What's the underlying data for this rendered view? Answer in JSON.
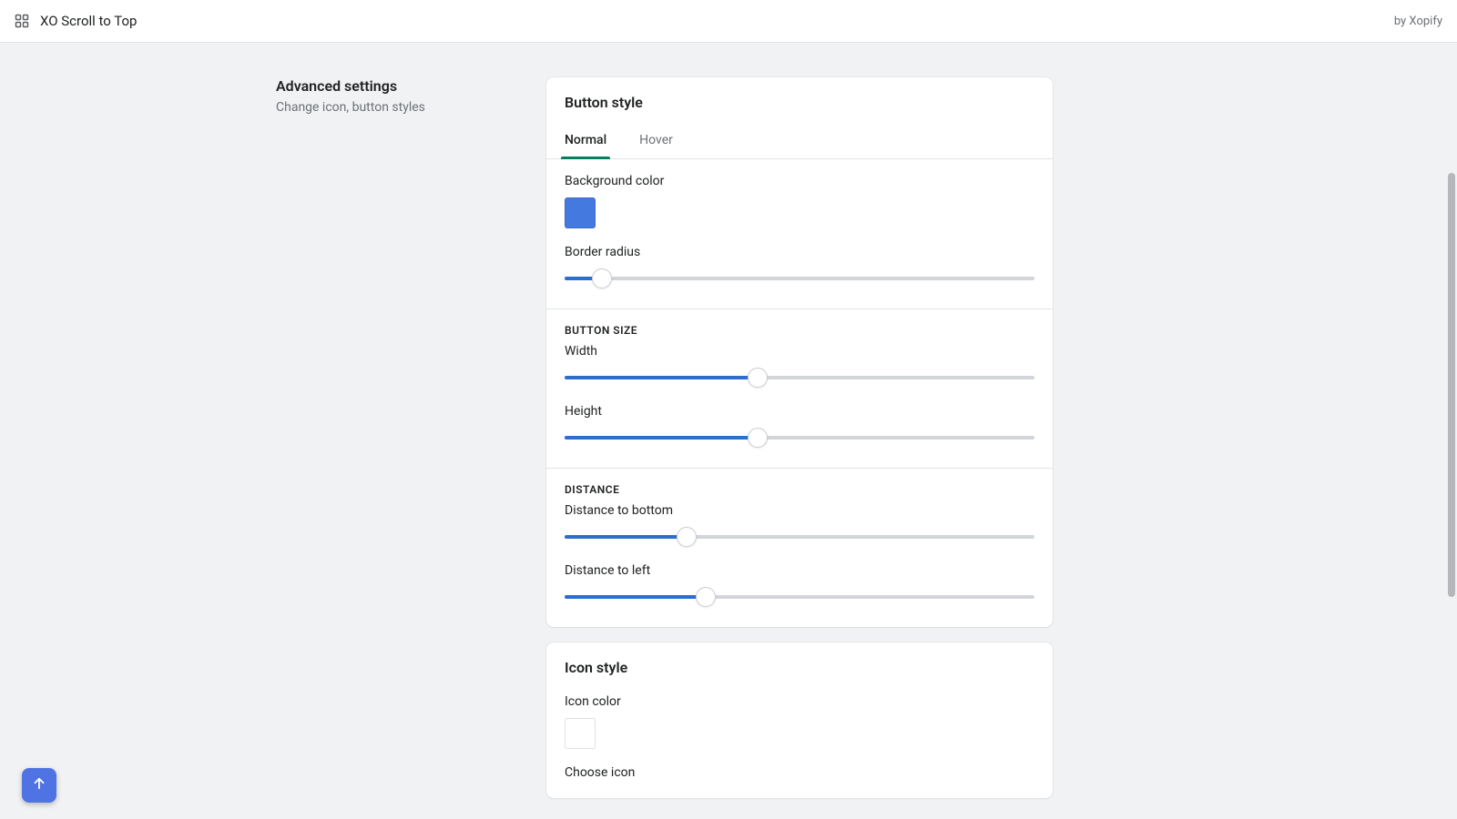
{
  "header": {
    "title": "XO Scroll to Top",
    "by_label": "by Xopify"
  },
  "sidebar": {
    "title": "Advanced settings",
    "subtitle": "Change icon, button styles"
  },
  "button_style": {
    "heading": "Button style",
    "tabs": {
      "normal": "Normal",
      "hover": "Hover"
    },
    "background_color": {
      "label": "Background color",
      "value": "#447ae0"
    },
    "border_radius": {
      "label": "Border radius",
      "percent": 8
    }
  },
  "button_size": {
    "heading": "BUTTON SIZE",
    "width": {
      "label": "Width",
      "percent": 41
    },
    "height": {
      "label": "Height",
      "percent": 41
    }
  },
  "distance": {
    "heading": "DISTANCE",
    "to_bottom": {
      "label": "Distance to bottom",
      "percent": 26
    },
    "to_left": {
      "label": "Distance to left",
      "percent": 30
    }
  },
  "icon_style": {
    "heading": "Icon style",
    "icon_color": {
      "label": "Icon color",
      "value": "#ffffff"
    },
    "choose_icon": {
      "label": "Choose icon"
    }
  },
  "scrollbar": {
    "thumb_top_pct": 15,
    "thumb_height_pct": 56
  }
}
